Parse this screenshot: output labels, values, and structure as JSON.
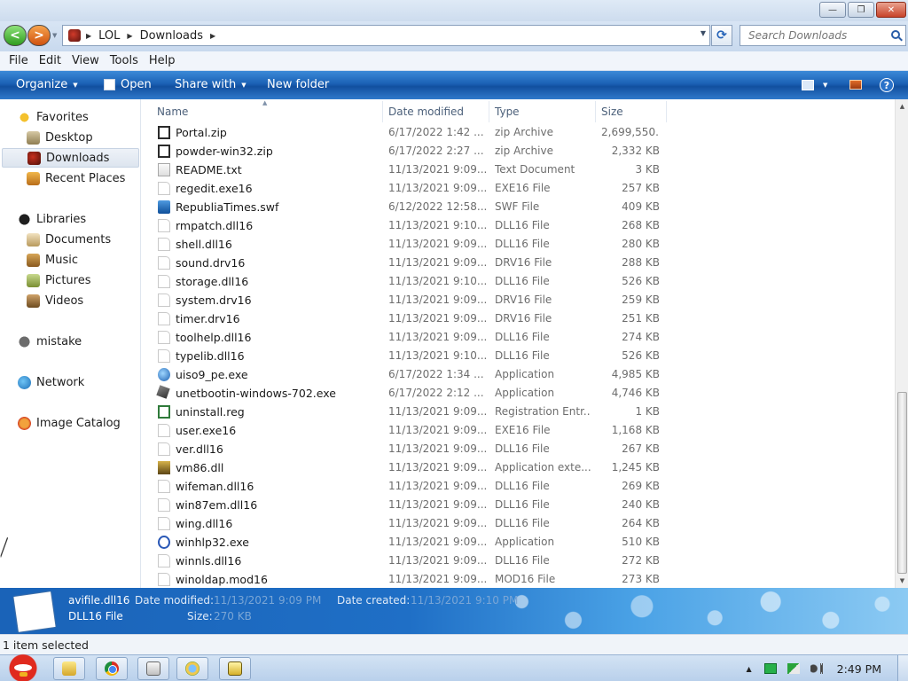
{
  "window": {
    "minimize_label": "—",
    "maximize_label": "❐",
    "close_label": "✕"
  },
  "address": {
    "crumbs": [
      "LOL",
      "Downloads"
    ],
    "refresh_label": "⟳"
  },
  "search": {
    "placeholder": "Search Downloads"
  },
  "menu": [
    "File",
    "Edit",
    "View",
    "Tools",
    "Help"
  ],
  "commands": {
    "organize": "Organize",
    "open": "Open",
    "share_with": "Share with",
    "new_folder": "New folder",
    "help": "?"
  },
  "nav": {
    "favorites": "Favorites",
    "desktop": "Desktop",
    "downloads": "Downloads",
    "recent_places": "Recent Places",
    "libraries": "Libraries",
    "documents": "Documents",
    "music": "Music",
    "pictures": "Pictures",
    "videos": "Videos",
    "mistake": "mistake",
    "network": "Network",
    "image_catalog": "Image Catalog"
  },
  "columns": {
    "name": "Name",
    "date_modified": "Date modified",
    "type": "Type",
    "size": "Size"
  },
  "files": [
    {
      "icon": "zip",
      "name": "Portal.zip",
      "date": "6/17/2022 1:42 ...",
      "type": "zip Archive",
      "size": "2,699,550..."
    },
    {
      "icon": "zip",
      "name": "powder-win32.zip",
      "date": "6/17/2022 2:27 ...",
      "type": "zip Archive",
      "size": "2,332 KB"
    },
    {
      "icon": "txt",
      "name": "README.txt",
      "date": "11/13/2021 9:09...",
      "type": "Text Document",
      "size": "3 KB"
    },
    {
      "icon": "generic",
      "name": "regedit.exe16",
      "date": "11/13/2021 9:09...",
      "type": "EXE16 File",
      "size": "257 KB"
    },
    {
      "icon": "swf",
      "name": "RepubliaTimes.swf",
      "date": "6/12/2022 12:58...",
      "type": "SWF File",
      "size": "409 KB"
    },
    {
      "icon": "generic",
      "name": "rmpatch.dll16",
      "date": "11/13/2021 9:10...",
      "type": "DLL16 File",
      "size": "268 KB"
    },
    {
      "icon": "generic",
      "name": "shell.dll16",
      "date": "11/13/2021 9:09...",
      "type": "DLL16 File",
      "size": "280 KB"
    },
    {
      "icon": "generic",
      "name": "sound.drv16",
      "date": "11/13/2021 9:09...",
      "type": "DRV16 File",
      "size": "288 KB"
    },
    {
      "icon": "generic",
      "name": "storage.dll16",
      "date": "11/13/2021 9:10...",
      "type": "DLL16 File",
      "size": "526 KB"
    },
    {
      "icon": "generic",
      "name": "system.drv16",
      "date": "11/13/2021 9:09...",
      "type": "DRV16 File",
      "size": "259 KB"
    },
    {
      "icon": "generic",
      "name": "timer.drv16",
      "date": "11/13/2021 9:09...",
      "type": "DRV16 File",
      "size": "251 KB"
    },
    {
      "icon": "generic",
      "name": "toolhelp.dll16",
      "date": "11/13/2021 9:09...",
      "type": "DLL16 File",
      "size": "274 KB"
    },
    {
      "icon": "generic",
      "name": "typelib.dll16",
      "date": "11/13/2021 9:10...",
      "type": "DLL16 File",
      "size": "526 KB"
    },
    {
      "icon": "app",
      "name": "uiso9_pe.exe",
      "date": "6/17/2022 1:34 ...",
      "type": "Application",
      "size": "4,985 KB"
    },
    {
      "icon": "tool",
      "name": "unetbootin-windows-702.exe",
      "date": "6/17/2022 2:12 ...",
      "type": "Application",
      "size": "4,746 KB"
    },
    {
      "icon": "reg",
      "name": "uninstall.reg",
      "date": "11/13/2021 9:09...",
      "type": "Registration Entr...",
      "size": "1 KB"
    },
    {
      "icon": "generic",
      "name": "user.exe16",
      "date": "11/13/2021 9:09...",
      "type": "EXE16 File",
      "size": "1,168 KB"
    },
    {
      "icon": "generic",
      "name": "ver.dll16",
      "date": "11/13/2021 9:09...",
      "type": "DLL16 File",
      "size": "267 KB"
    },
    {
      "icon": "vm",
      "name": "vm86.dll",
      "date": "11/13/2021 9:09...",
      "type": "Application exte...",
      "size": "1,245 KB"
    },
    {
      "icon": "generic",
      "name": "wifeman.dll16",
      "date": "11/13/2021 9:09...",
      "type": "DLL16 File",
      "size": "269 KB"
    },
    {
      "icon": "generic",
      "name": "win87em.dll16",
      "date": "11/13/2021 9:09...",
      "type": "DLL16 File",
      "size": "240 KB"
    },
    {
      "icon": "generic",
      "name": "wing.dll16",
      "date": "11/13/2021 9:09...",
      "type": "DLL16 File",
      "size": "264 KB"
    },
    {
      "icon": "help",
      "name": "winhlp32.exe",
      "date": "11/13/2021 9:09...",
      "type": "Application",
      "size": "510 KB"
    },
    {
      "icon": "generic",
      "name": "winnls.dll16",
      "date": "11/13/2021 9:09...",
      "type": "DLL16 File",
      "size": "272 KB"
    },
    {
      "icon": "generic",
      "name": "winoldap.mod16",
      "date": "11/13/2021 9:09...",
      "type": "MOD16 File",
      "size": "273 KB"
    }
  ],
  "details": {
    "name": "avifile.dll16",
    "type": "DLL16 File",
    "date_modified_label": "Date modified:",
    "date_modified": "11/13/2021 9:09 PM",
    "size_label": "Size:",
    "size": "270 KB",
    "date_created_label": "Date created:",
    "date_created": "11/13/2021 9:10 PM"
  },
  "status": {
    "text": "1 item selected"
  },
  "tray": {
    "clock": "2:49 PM"
  }
}
